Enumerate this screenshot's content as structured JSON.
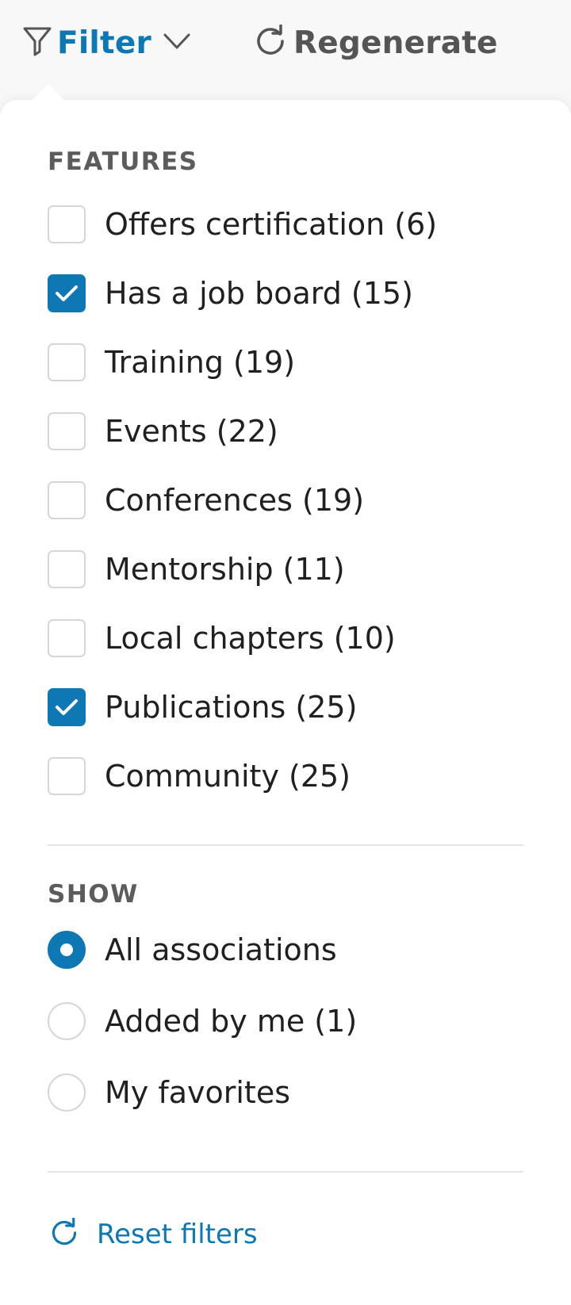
{
  "toolbar": {
    "filter_label": "Filter",
    "regenerate_label": "Regenerate"
  },
  "features": {
    "title": "FEATURES",
    "options": [
      {
        "label": "Offers certification (6)",
        "checked": false
      },
      {
        "label": "Has a job board (15)",
        "checked": true
      },
      {
        "label": "Training (19)",
        "checked": false
      },
      {
        "label": "Events (22)",
        "checked": false
      },
      {
        "label": "Conferences (19)",
        "checked": false
      },
      {
        "label": "Mentorship (11)",
        "checked": false
      },
      {
        "label": "Local chapters (10)",
        "checked": false
      },
      {
        "label": "Publications (25)",
        "checked": true
      },
      {
        "label": "Community (25)",
        "checked": false
      }
    ]
  },
  "show": {
    "title": "SHOW",
    "options": [
      {
        "label": "All associations",
        "selected": true
      },
      {
        "label": "Added by me (1)",
        "selected": false
      },
      {
        "label": "My favorites",
        "selected": false
      }
    ]
  },
  "reset_label": "Reset filters",
  "colors": {
    "accent": "#0e78b4",
    "border": "#d6d6d6",
    "section_title": "#5c5c5c"
  }
}
